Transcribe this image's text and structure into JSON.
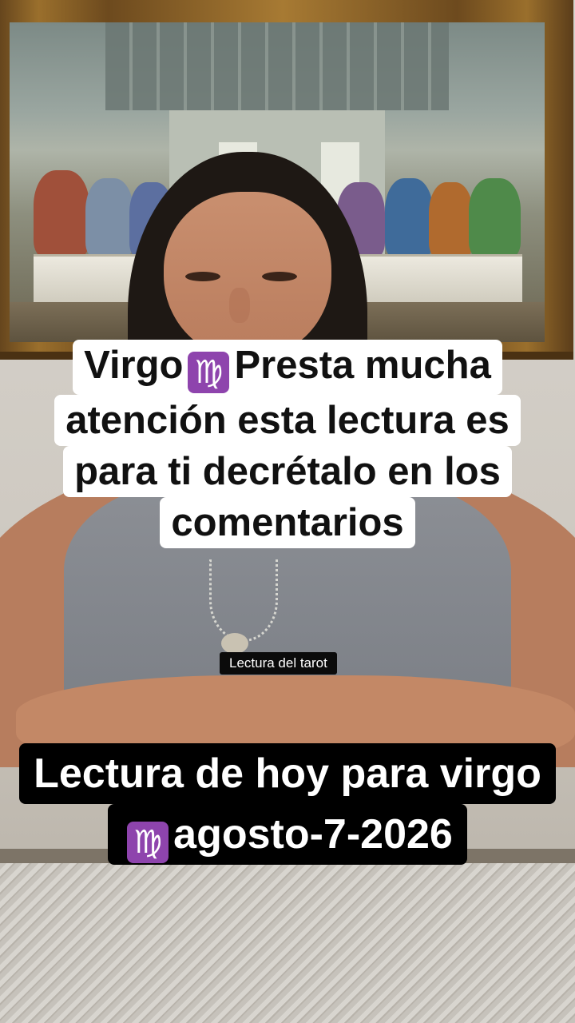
{
  "overlay": {
    "top_caption": {
      "line1_before": "Virgo",
      "line1_emoji": "♍",
      "line1_after": "Presta mucha",
      "line2": "atención esta lectura es",
      "line3": "para ti decrétalo en los",
      "line4": "comentarios"
    },
    "center_label": "Lectura del tarot",
    "bottom_caption": {
      "line1": "Lectura de hoy para virgo",
      "line2_emoji": "♍",
      "line2_text": "agosto-7-2026"
    }
  },
  "colors": {
    "emoji_bg": "#8e44ad",
    "caption_light_bg": "#ffffff",
    "caption_dark_bg": "#000000"
  }
}
